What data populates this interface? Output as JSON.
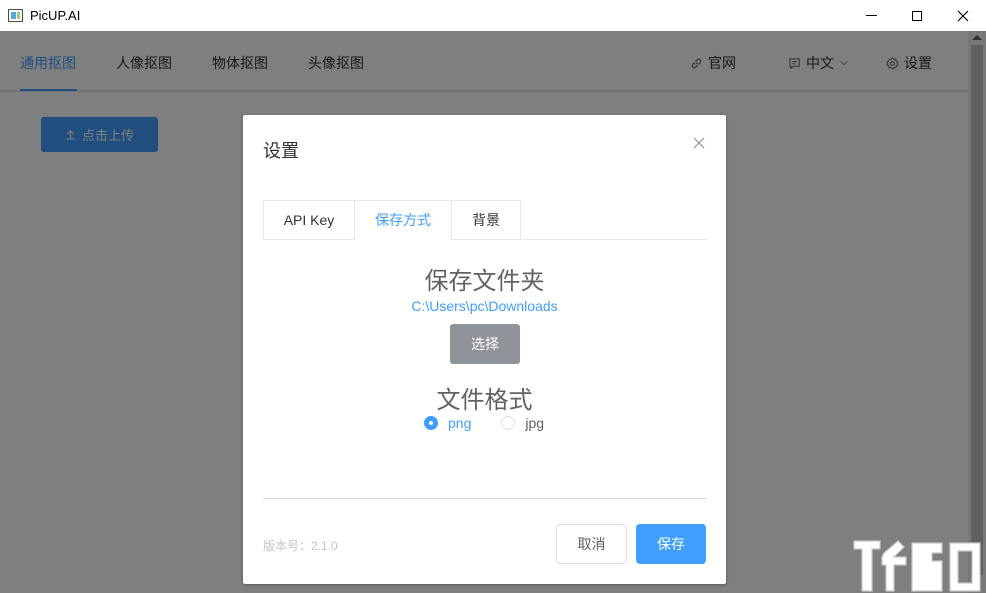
{
  "window": {
    "title": "PicUP.AI"
  },
  "nav": {
    "tabs": [
      "通用抠图",
      "人像抠图",
      "物体抠图",
      "头像抠图"
    ],
    "active_tab": 0,
    "links": {
      "website": "官网",
      "language": "中文",
      "settings": "设置"
    }
  },
  "upload_button": "点击上传",
  "dialog": {
    "title": "设置",
    "tabs": [
      "API Key",
      "保存方式",
      "背景"
    ],
    "active_tab": 1,
    "folder_title": "保存文件夹",
    "folder_path": "C:\\Users\\pc\\Downloads",
    "choose_button": "选择",
    "format_title": "文件格式",
    "formats": [
      {
        "label": "png",
        "checked": true
      },
      {
        "label": "jpg",
        "checked": false
      }
    ],
    "version": "版本号：2.1.0",
    "cancel_button": "取消",
    "save_button": "保存"
  },
  "colors": {
    "accent": "#409eff",
    "overlay": "rgba(0,0,0,0.5)",
    "secondary_button": "#909399"
  },
  "icons": {
    "website": "link-icon",
    "language": "message-icon",
    "settings": "gear-icon",
    "upload": "upload-arrow-icon",
    "dialog_close": "close-icon"
  }
}
